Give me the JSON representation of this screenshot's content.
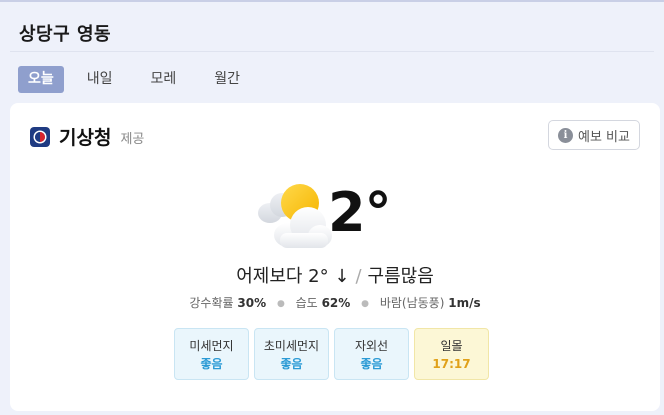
{
  "location": "상당구 영동",
  "tabs": [
    {
      "label": "오늘"
    },
    {
      "label": "내일"
    },
    {
      "label": "모레"
    },
    {
      "label": "월간"
    }
  ],
  "provider": {
    "name": "기상청",
    "suffix": "제공",
    "logo_icon": "kma-logo-icon"
  },
  "compare_button": {
    "label": "예보 비교",
    "icon": "info-icon"
  },
  "current": {
    "weather_icon": "partly-cloudy-icon",
    "temperature": "2°",
    "compare_text": "어제보다 2° ↓",
    "separator": "/",
    "condition": "구름많음"
  },
  "details": {
    "precip_label": "강수확률",
    "precip_value": "30%",
    "humidity_label": "습도",
    "humidity_value": "62%",
    "wind_label": "바람(남동풍)",
    "wind_value": "1m/s"
  },
  "chips": [
    {
      "label": "미세먼지",
      "value": "좋음"
    },
    {
      "label": "초미세먼지",
      "value": "좋음"
    },
    {
      "label": "자외선",
      "value": "좋음"
    },
    {
      "label": "일몰",
      "value": "17:17"
    }
  ],
  "colors": {
    "accent_tab": "#8f9fcd",
    "good": "#2a9ad5",
    "sunset": "#e0a11a"
  }
}
